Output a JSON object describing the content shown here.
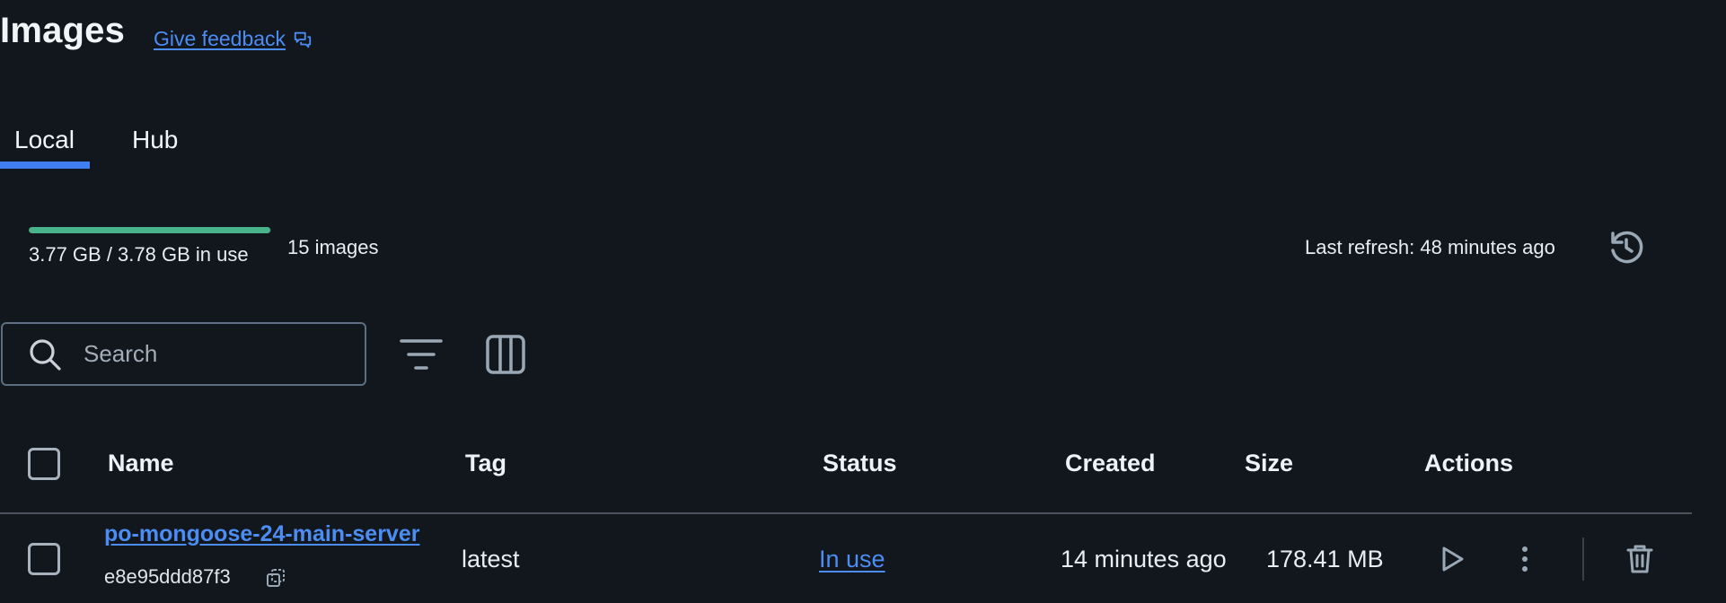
{
  "header": {
    "title": "Images",
    "feedback_label": "Give feedback"
  },
  "tabs": [
    {
      "label": "Local",
      "active": true
    },
    {
      "label": "Hub",
      "active": false
    }
  ],
  "usage": {
    "text": "3.77 GB / 3.78 GB in use",
    "fraction_used": 0.997,
    "image_count": "15 images",
    "last_refresh": "Last refresh: 48 minutes ago"
  },
  "search": {
    "placeholder": "Search",
    "value": ""
  },
  "table": {
    "columns": [
      "Name",
      "Tag",
      "Status",
      "Created",
      "Size",
      "Actions"
    ],
    "rows": [
      {
        "name": "po-mongoose-24-main-server",
        "id": "e8e95ddd87f3",
        "tag": "latest",
        "status": "In use",
        "created": "14 minutes ago",
        "size": "178.41 MB"
      }
    ]
  },
  "icons": {
    "feedback": "chat-bubbles-icon",
    "refresh": "refresh-icon",
    "search": "search-icon",
    "filter": "filter-icon",
    "columns": "columns-icon",
    "copy": "copy-icon",
    "run": "play-icon",
    "more": "more-vertical-icon",
    "delete": "trash-icon"
  },
  "colors": {
    "background": "#12161d",
    "link": "#4b8df2",
    "accent_tab": "#3f7ef3",
    "usage_fill": "#49b48a"
  }
}
